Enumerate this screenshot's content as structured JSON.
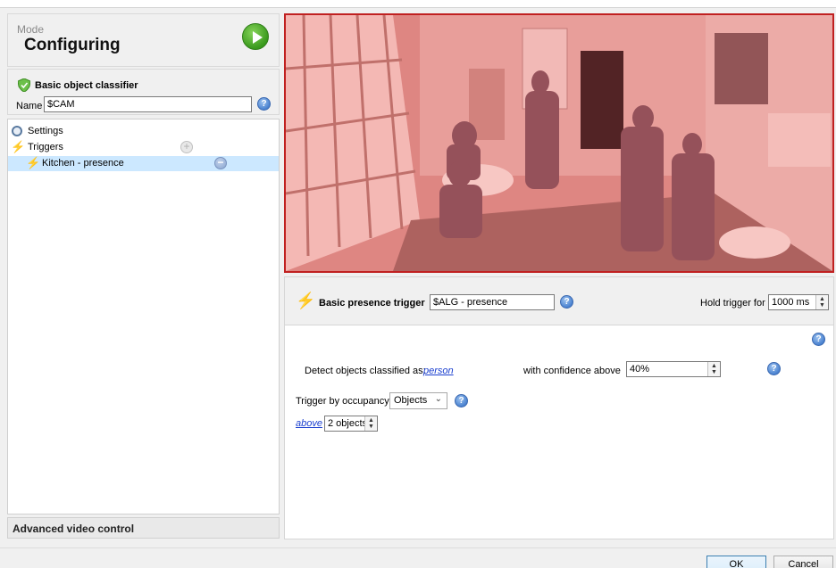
{
  "mode": {
    "label": "Mode",
    "value": "Configuring",
    "play_icon": "play-icon"
  },
  "classifier": {
    "title": "Basic object classifier",
    "name_label": "Name",
    "name_value": "$CAM"
  },
  "tree": {
    "settings": "Settings",
    "triggers": "Triggers",
    "kitchen": "Kitchen - presence"
  },
  "advanced": {
    "title": "Advanced video control"
  },
  "trigger": {
    "title": "Basic presence trigger",
    "name_value": "$ALG - presence",
    "hold_label": "Hold trigger for",
    "hold_value": "1000 ms",
    "detect_label": "Detect objects classified as:",
    "detect_value": "person",
    "confidence_label": "with confidence above",
    "confidence_value": "40%",
    "occupancy_label": "Trigger by occupancy:",
    "occupancy_value": "Objects",
    "above_link": "above",
    "objects_value": "2 objects"
  },
  "buttons": {
    "ok": "OK",
    "cancel": "Cancel"
  },
  "colors": {
    "accent_red": "#c02020",
    "selection": "#cce8ff",
    "link": "#1a3fcf"
  }
}
